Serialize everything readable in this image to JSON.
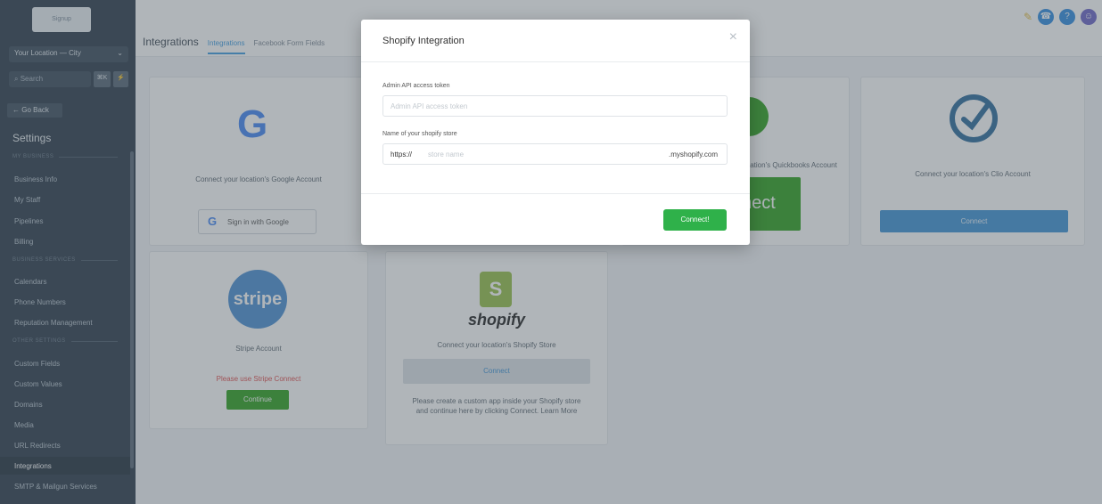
{
  "sidebar": {
    "logo": "Signup",
    "location": "Your Location — City",
    "search_placeholder": "Search",
    "shortcut": "⌘K",
    "go_back": "← Go Back",
    "title": "Settings",
    "sections": [
      "MY BUSINESS",
      "BUSINESS SERVICES",
      "OTHER SETTINGS"
    ],
    "items": [
      "Business Info",
      "My Staff",
      "Pipelines",
      "Billing",
      "Calendars",
      "Phone Numbers",
      "Reputation Management",
      "Custom Fields",
      "Custom Values",
      "Domains",
      "Media",
      "URL Redirects",
      "Integrations",
      "SMTP & Mailgun Services"
    ]
  },
  "header": {
    "title": "Integrations",
    "tabs": [
      "Integrations",
      "Facebook Form Fields"
    ]
  },
  "cards": {
    "google": {
      "text": "Connect your location's Google Account",
      "button": "Sign in with Google",
      "logo": "G"
    },
    "stripe": {
      "logo": "stripe",
      "text": "Stripe Account",
      "warning": "Please use Stripe Connect",
      "button": "Continue"
    },
    "shopify": {
      "logo": "shopify",
      "text": "Connect your location's Shopify Store",
      "button": "Connect",
      "note": "Please create a custom app inside your Shopify store and continue here by clicking Connect. Learn More"
    },
    "quickbooks": {
      "text": "Connect your location's Quickbooks Account",
      "button": "nect"
    },
    "clio": {
      "text": "Connect your location's Clio Account",
      "button": "Connect"
    }
  },
  "modal": {
    "title": "Shopify Integration",
    "token_label": "Admin API access token",
    "token_placeholder": "Admin API access token",
    "store_label": "Name of your shopify store",
    "store_prefix": "https://",
    "store_placeholder": "store name",
    "store_suffix": ".myshopify.com",
    "connect_label": "Connect!",
    "close": "×"
  },
  "colors": {
    "accent": "#3c9be0",
    "success": "#2fb14a",
    "sidebar": "#2b3a49"
  }
}
